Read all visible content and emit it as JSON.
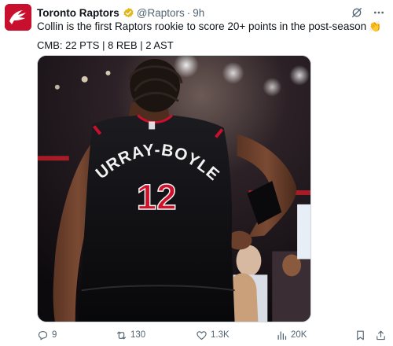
{
  "account": {
    "display_name": "Toronto Raptors",
    "handle": "@Raptors",
    "separator": "·",
    "time": "9h",
    "avatar_icon": "raptors-logo-icon",
    "brand_color": "#c8102e",
    "verified_color": "#e2b719"
  },
  "tweet": {
    "text": "Collin is the first Raptors rookie to score 20+ points in the post-season",
    "emoji": "👏",
    "stat_line": "CMB: 22 PTS | 8 REB | 2 AST"
  },
  "media": {
    "jersey_name": "MURRAY-BOYLES",
    "jersey_number": "12",
    "jersey_color": "#111114",
    "number_color": "#d0102a"
  },
  "actions": {
    "replies": "9",
    "reposts": "130",
    "likes": "1.3K",
    "views": "20K",
    "muted_color": "#536471"
  }
}
